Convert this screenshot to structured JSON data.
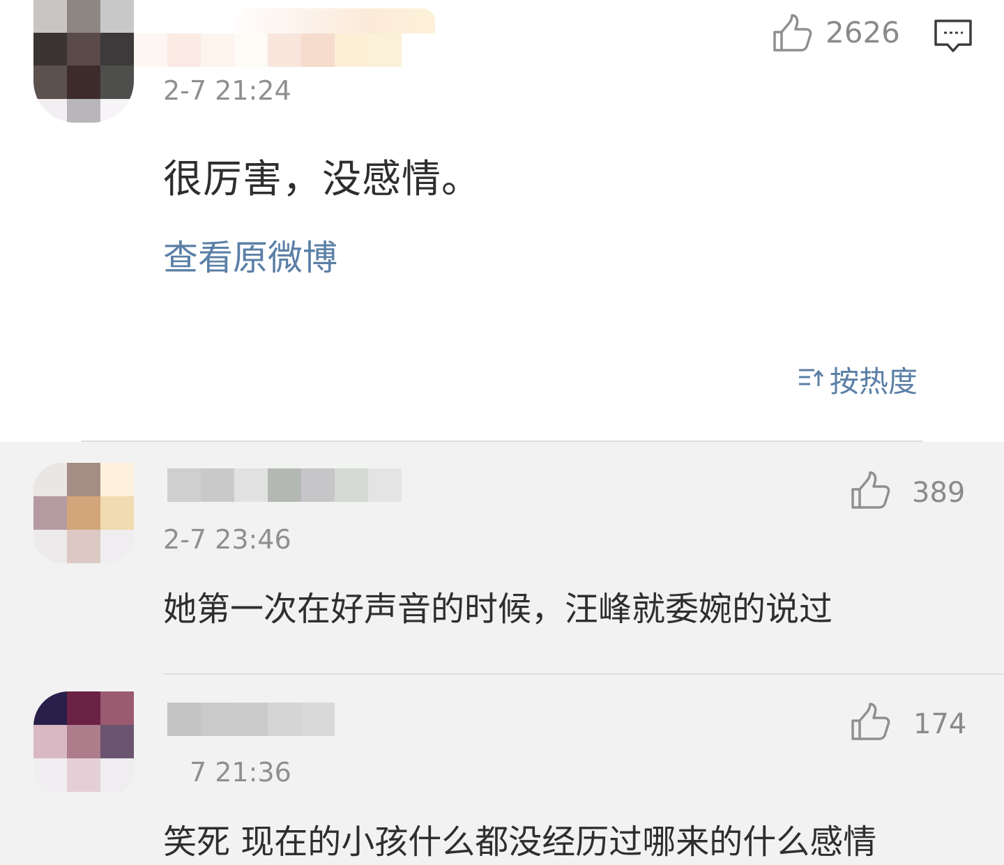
{
  "main_comment": {
    "timestamp": "2-7 21:24",
    "text": "很厉害，没感情。",
    "likes": "2626",
    "view_original_label": "查看原微博"
  },
  "sort": {
    "label": "按热度"
  },
  "replies": [
    {
      "timestamp": "2-7 23:46",
      "text": "她第一次在好声音的时候，汪峰就委婉的说过",
      "likes": "389"
    },
    {
      "timestamp": "7 21:36",
      "text": "笑死 现在的小孩什么都没经历过哪来的什么感情",
      "likes": "174"
    }
  ],
  "colors": {
    "link_blue": "#5b7fa6",
    "timestamp_grey": "#8f8f8f",
    "reply_bg": "#f2f2f2"
  },
  "icons": [
    "thumbs-up-icon",
    "comment-icon",
    "sort-icon"
  ]
}
